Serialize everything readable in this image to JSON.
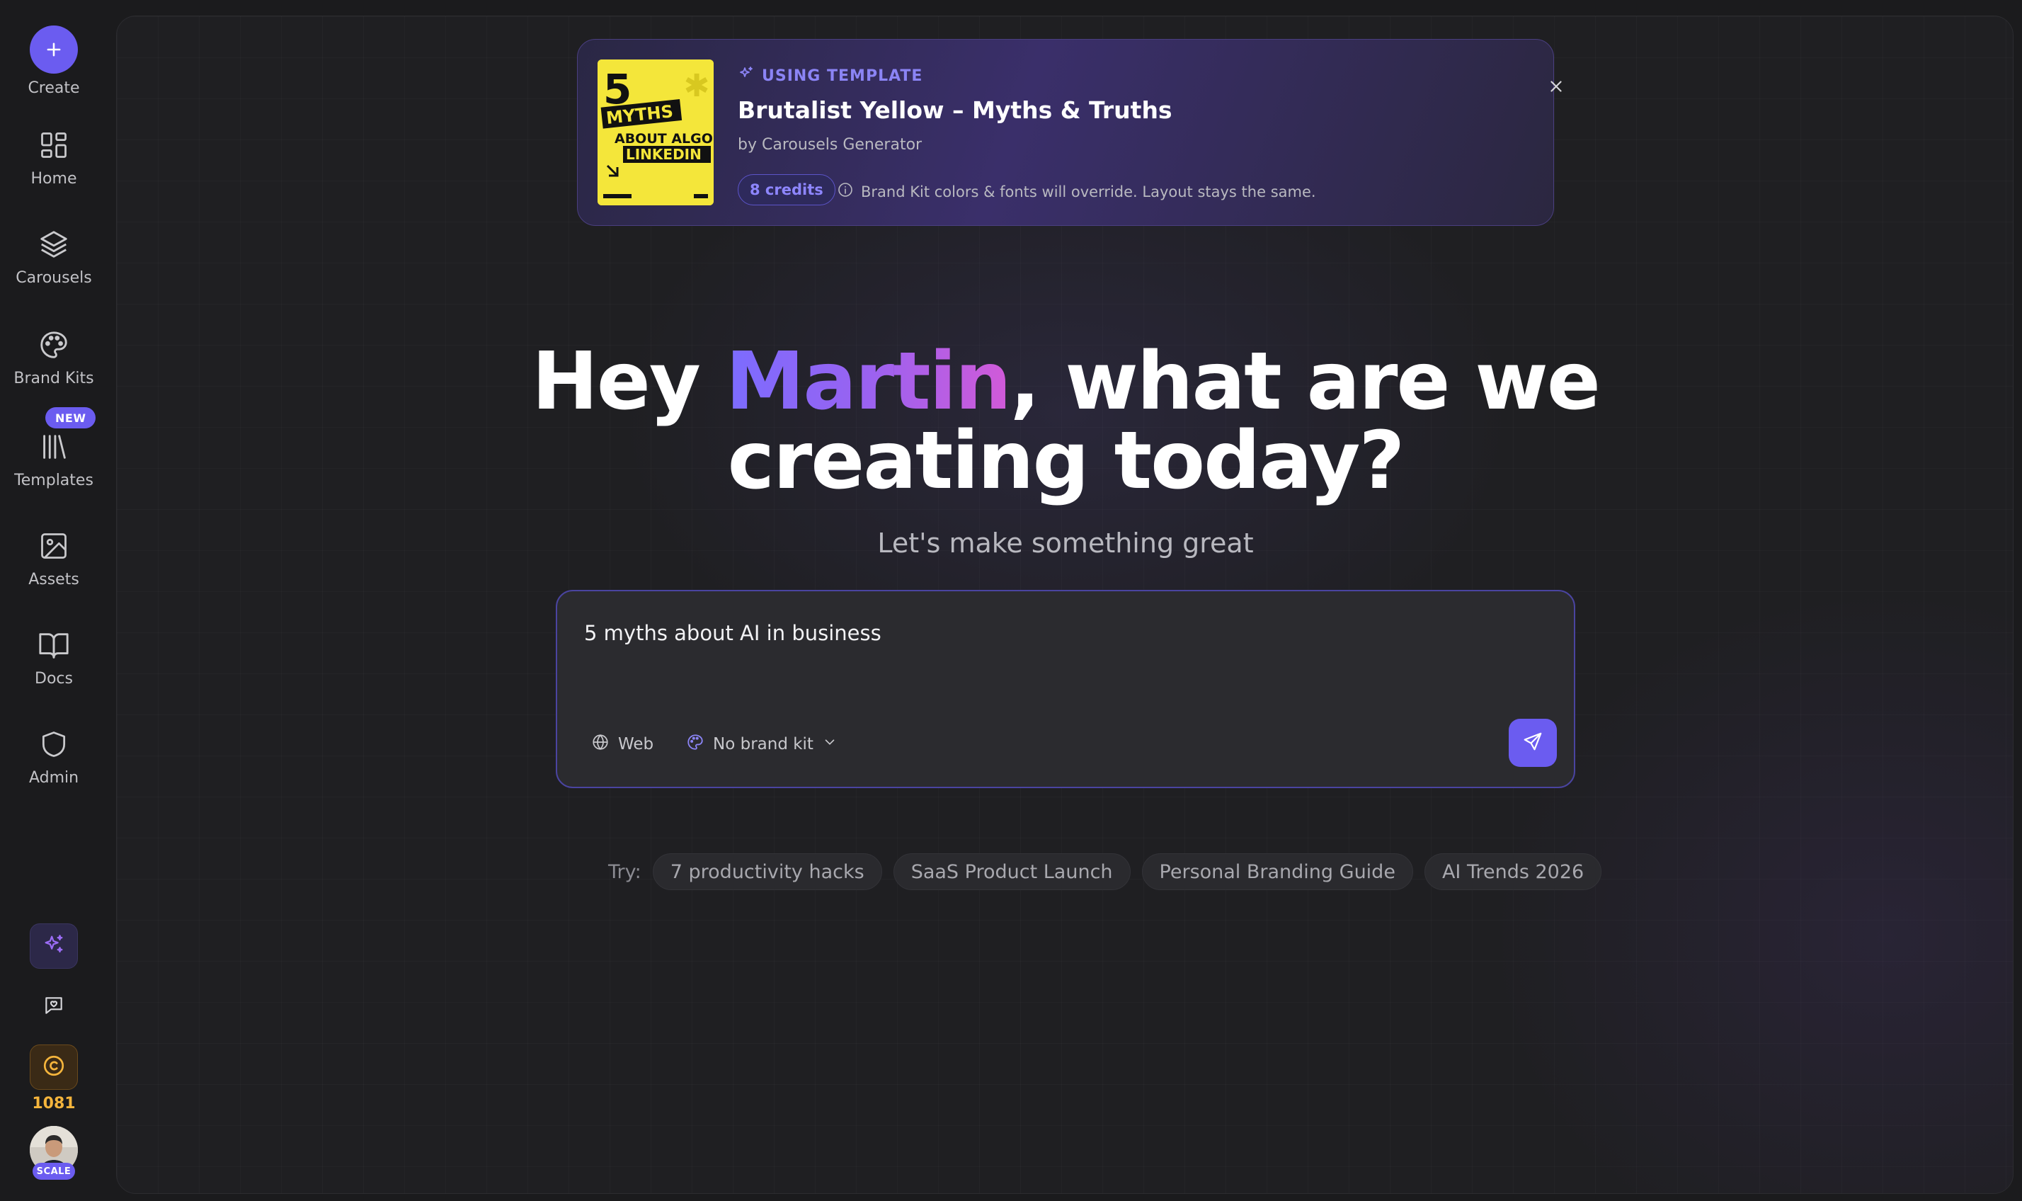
{
  "sidebar": {
    "create_label": "Create",
    "items": [
      {
        "label": "Home"
      },
      {
        "label": "Carousels"
      },
      {
        "label": "Brand Kits"
      },
      {
        "label": "Templates"
      },
      {
        "label": "Assets"
      },
      {
        "label": "Docs"
      },
      {
        "label": "Admin"
      }
    ],
    "new_badge": "NEW",
    "credits": "1081",
    "plan_badge": "SCALE"
  },
  "template_banner": {
    "using_label": "USING TEMPLATE",
    "title": "Brutalist Yellow – Myths & Truths",
    "author": "by Carousels Generator",
    "credits": "8 credits",
    "note": "Brand Kit colors & fonts will override. Layout stays the same.",
    "thumbnail": {
      "number": "5",
      "line1": "MYTHS",
      "line2": "ABOUT ALGO",
      "line3": "LINKEDIN",
      "accent_color": "#f4e63a"
    }
  },
  "hero": {
    "greeting_prefix": "Hey ",
    "name": "Martin",
    "greeting_suffix": ", what are we",
    "line2": "creating today?",
    "subtitle": "Let's make something great"
  },
  "prompt": {
    "value": "5 myths about AI in business",
    "web_label": "Web",
    "brand_kit_label": "No brand kit"
  },
  "suggestions": {
    "label": "Try:",
    "items": [
      "7 productivity hacks",
      "SaaS Product Launch",
      "Personal Branding Guide",
      "AI Trends 2026"
    ]
  },
  "colors": {
    "accent": "#6b5cf0",
    "credit": "#f5b53c",
    "background": "#1b1b1d"
  }
}
